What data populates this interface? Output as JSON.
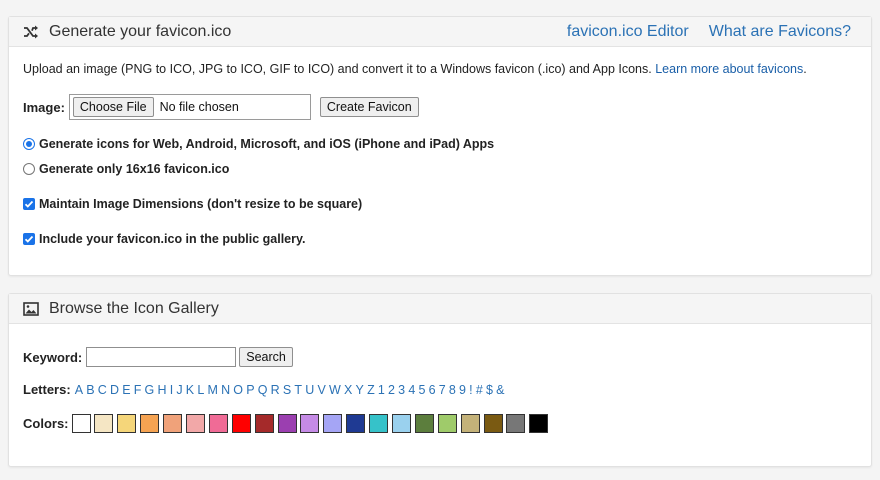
{
  "generate_panel": {
    "title": "Generate your favicon.ico",
    "links": [
      "favicon.ico Editor",
      "What are Favicons?"
    ],
    "intro_text": "Upload an image (PNG to ICO, JPG to ICO, GIF to ICO) and convert it to a Windows favicon (.ico) and App Icons.",
    "intro_link": "Learn more about favicons",
    "image_label": "Image:",
    "choose_file_label": "Choose File",
    "file_status": "No file chosen",
    "create_button": "Create Favicon",
    "radio_all": "Generate icons for Web, Android, Microsoft, and iOS (iPhone and iPad) Apps",
    "radio_16": "Generate only 16x16 favicon.ico",
    "check_dimensions": "Maintain Image Dimensions (don't resize to be square)",
    "check_gallery": "Include your favicon.ico in the public gallery."
  },
  "gallery_panel": {
    "title": "Browse the Icon Gallery",
    "keyword_label": "Keyword:",
    "keyword_value": "",
    "search_button": "Search",
    "letters_label": "Letters:",
    "letters": [
      "A",
      "B",
      "C",
      "D",
      "E",
      "F",
      "G",
      "H",
      "I",
      "J",
      "K",
      "L",
      "M",
      "N",
      "O",
      "P",
      "Q",
      "R",
      "S",
      "T",
      "U",
      "V",
      "W",
      "X",
      "Y",
      "Z",
      "1",
      "2",
      "3",
      "4",
      "5",
      "6",
      "7",
      "8",
      "9",
      "!",
      "#",
      "$",
      "&"
    ],
    "colors_label": "Colors:",
    "colors": [
      "#ffffff",
      "#f5e6c4",
      "#f5d67a",
      "#f5a352",
      "#f0a27a",
      "#f2a8a8",
      "#f06b96",
      "#ff0000",
      "#a52a2a",
      "#9b3fb0",
      "#c58be6",
      "#a5a5f5",
      "#1f3a93",
      "#36c2c9",
      "#9ad1ee",
      "#5c7e3d",
      "#9fcb6a",
      "#c4b279",
      "#7a5a12",
      "#777777",
      "#000000"
    ]
  },
  "theme": {
    "link_color": "#2b72b5",
    "accent": "#1a73e8"
  }
}
